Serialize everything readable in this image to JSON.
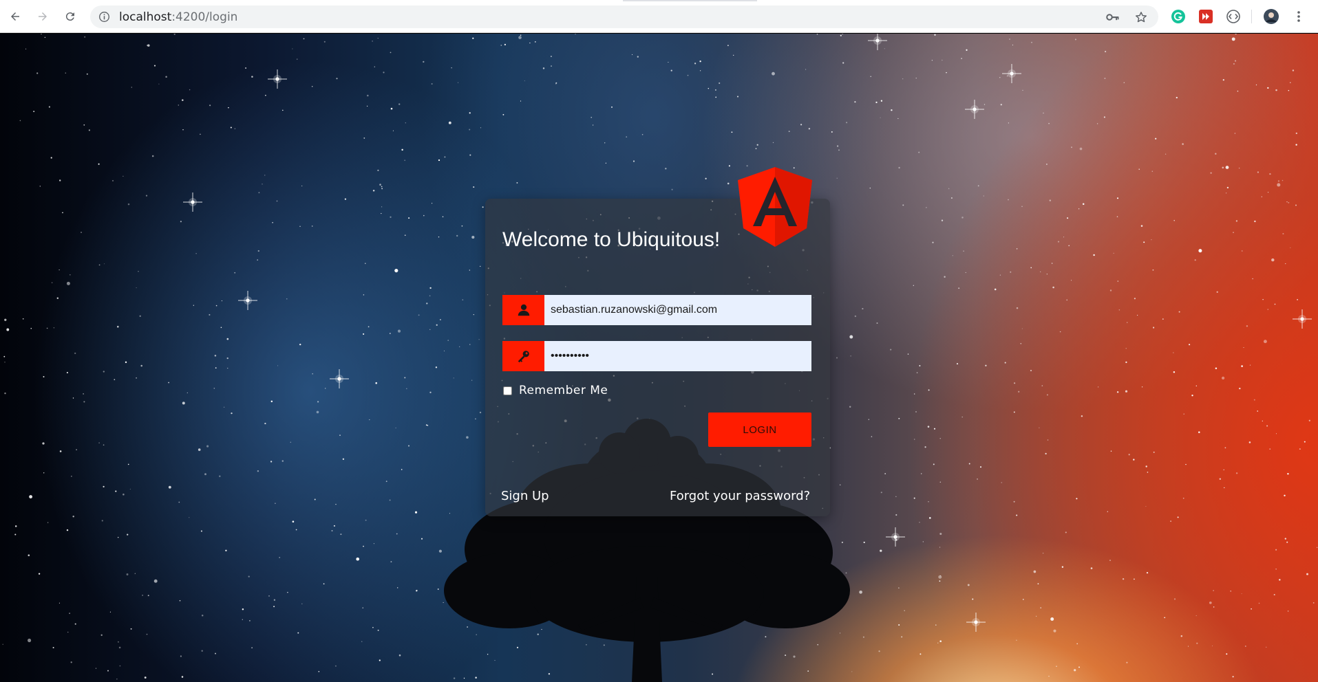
{
  "browser": {
    "url_host": "localhost",
    "url_path": ":4200/login",
    "icons": [
      "back-arrow-icon",
      "forward-arrow-icon",
      "reload-icon",
      "site-info-icon",
      "key-icon",
      "star-icon",
      "grammarly-extension-icon",
      "red-extension-icon",
      "code-extension-icon",
      "profile-avatar",
      "menu-dots-icon"
    ]
  },
  "login": {
    "welcome_title": "Welcome to Ubiquitous!",
    "email_value": "sebastian.ruzanowski@gmail.com",
    "password_value": "••••••••••",
    "remember_label": "Remember Me",
    "login_label": "LOGIN",
    "signup_label": "Sign Up",
    "forgot_label": "Forgot your password?"
  },
  "colors": {
    "accent": "#ff1c00",
    "input_bg": "#e8f0fe",
    "card_bg": "#34373e",
    "angular_red": "#dd0031",
    "angular_dark": "#c3002f"
  }
}
